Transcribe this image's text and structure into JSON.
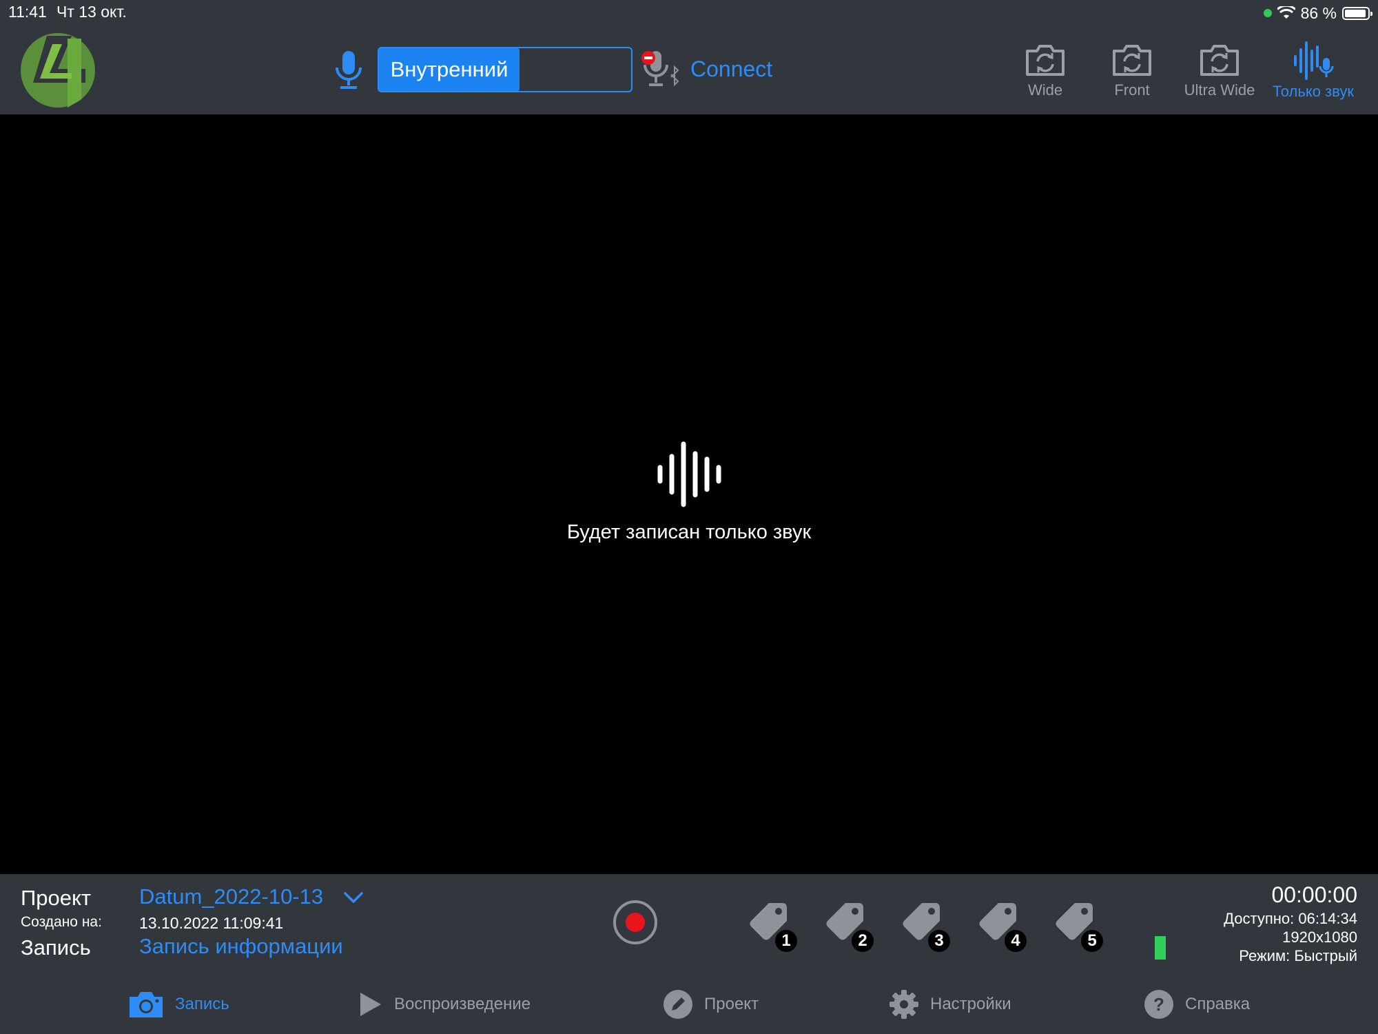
{
  "status_bar": {
    "time": "11:41",
    "date": "Чт 13 окт.",
    "battery": "86 %"
  },
  "audio_input": {
    "segment_active": "Внутренний",
    "connect_label": "Connect"
  },
  "cameras": [
    {
      "label": "Wide",
      "icon": "camera-switch-icon"
    },
    {
      "label": "Front",
      "icon": "camera-switch-icon"
    },
    {
      "label": "Ultra Wide",
      "icon": "camera-switch-icon"
    },
    {
      "label": "Только звук",
      "icon": "audio-only-icon",
      "selected": true
    }
  ],
  "preview": {
    "message": "Будет записан только звук"
  },
  "project_panel": {
    "project_label": "Проект",
    "project_value": "Datum_2022-10-13",
    "created_label": "Создано на:",
    "created_value": "13.10.2022 11:09:41",
    "record_label": "Запись",
    "record_value": "Запись информации"
  },
  "tags": [
    "1",
    "2",
    "3",
    "4",
    "5"
  ],
  "recording_info": {
    "timer": "00:00:00",
    "available": "Доступно: 06:14:34",
    "resolution": "1920x1080",
    "mode": "Режим: Быстрый"
  },
  "nav": [
    {
      "label": "Запись",
      "icon": "camera-icon",
      "active": true
    },
    {
      "label": "Воспроизведение",
      "icon": "play-icon"
    },
    {
      "label": "Проект",
      "icon": "pencil-icon"
    },
    {
      "label": "Настройки",
      "icon": "gear-icon"
    },
    {
      "label": "Справка",
      "icon": "help-icon"
    }
  ],
  "colors": {
    "accent": "#2f8cf5",
    "bar_bg": "#32373d",
    "record_red": "#e8161b",
    "level_green": "#30d158"
  }
}
